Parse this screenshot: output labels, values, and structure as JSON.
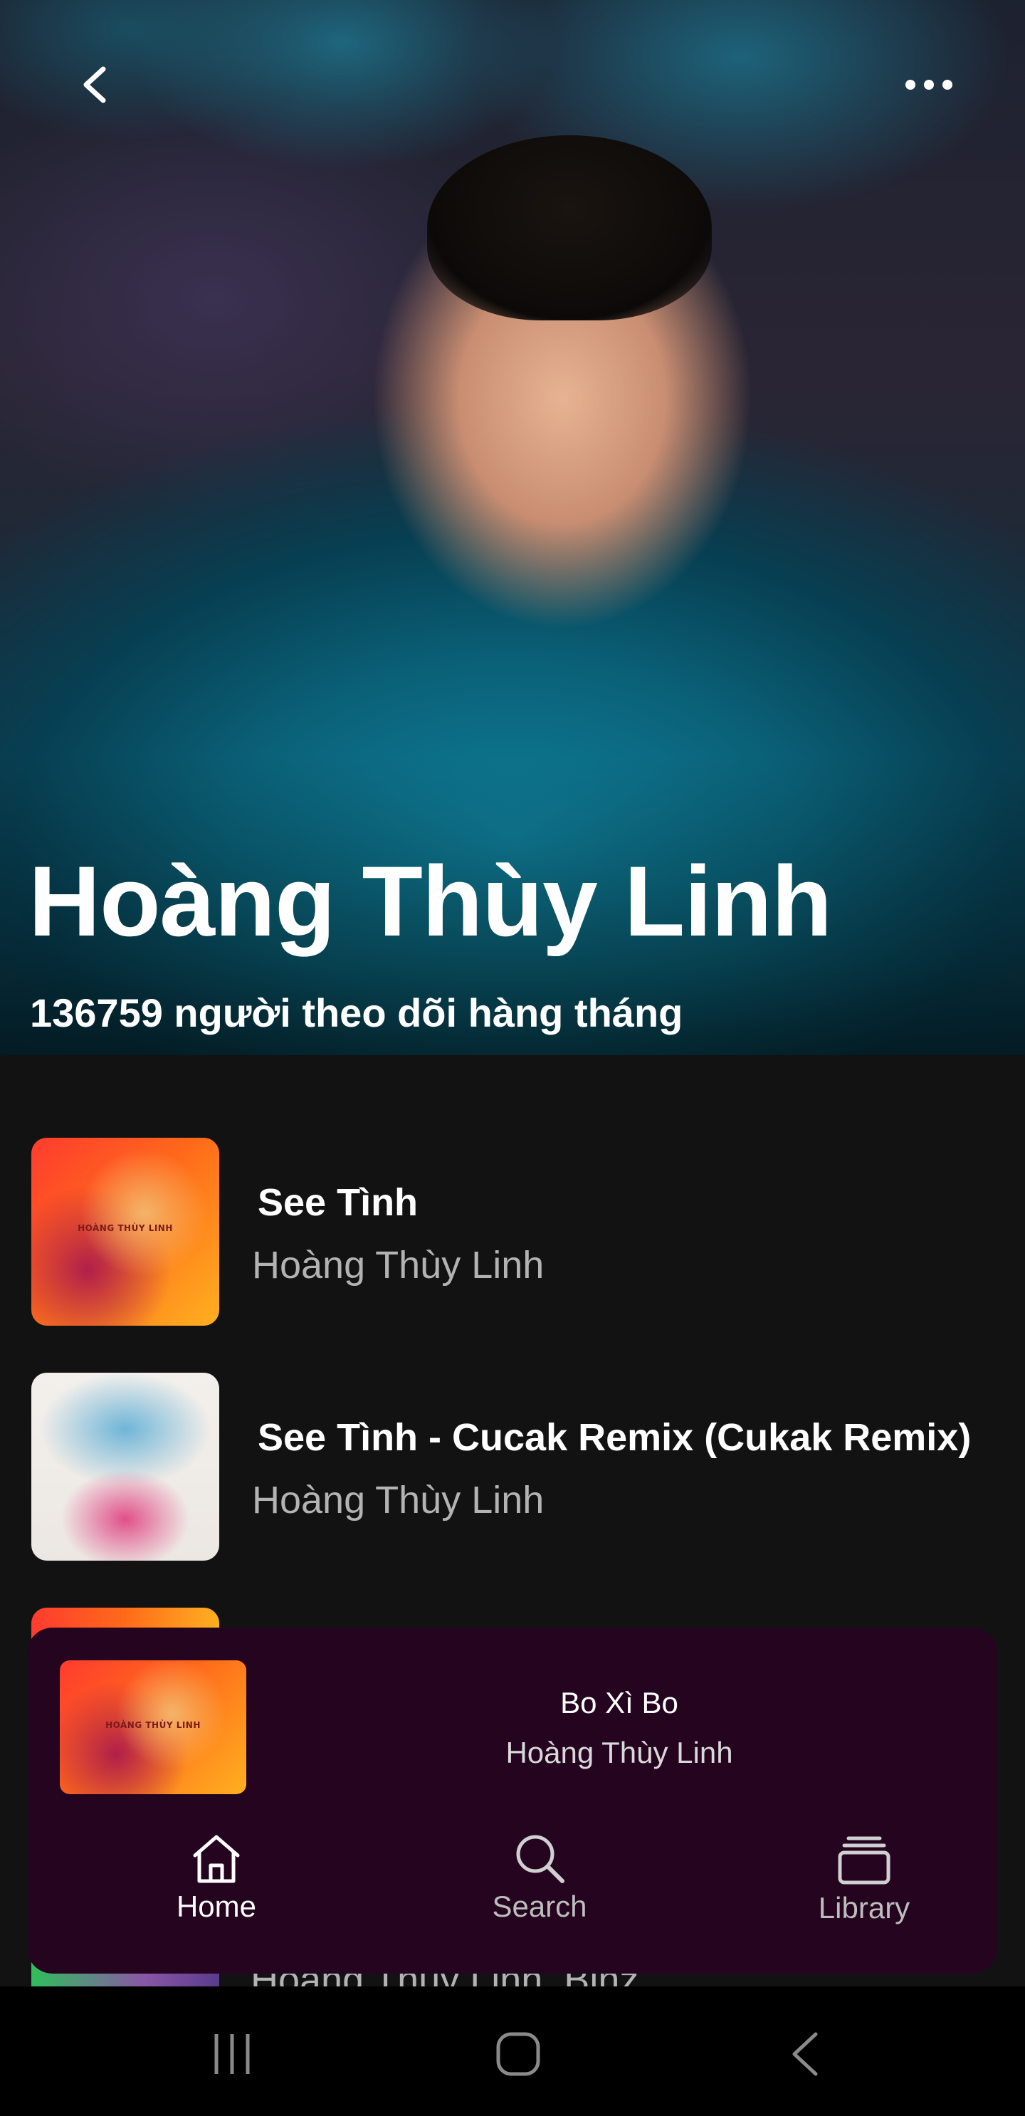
{
  "header": {
    "back_icon": "chevron-left-icon",
    "more_icon": "more-horizontal-icon"
  },
  "artist": {
    "name": "Hoàng Thùy Linh",
    "monthly_listeners": "136759 người theo dõi hàng tháng"
  },
  "tracks": [
    {
      "title": "See Tình",
      "artist": "Hoàng Thùy Linh",
      "cover_text": "HOÀNG THÙY LINH"
    },
    {
      "title": "See Tình - Cucak Remix (Cukak Remix)",
      "artist": "Hoàng Thùy Linh"
    }
  ],
  "partial_track": {
    "artist": "Hoàng Thùy Linh, Binz"
  },
  "now_playing": {
    "title": "Bo Xì Bo",
    "artist": "Hoàng Thùy Linh",
    "cover_text": "HOÀNG THÙY LINH",
    "background": "#250420"
  },
  "bottom_nav": {
    "home": "Home",
    "search": "Search",
    "library": "Library"
  },
  "colors": {
    "background": "#121212",
    "secondary_text": "#b3b3b3",
    "player_bg": "#250420"
  }
}
